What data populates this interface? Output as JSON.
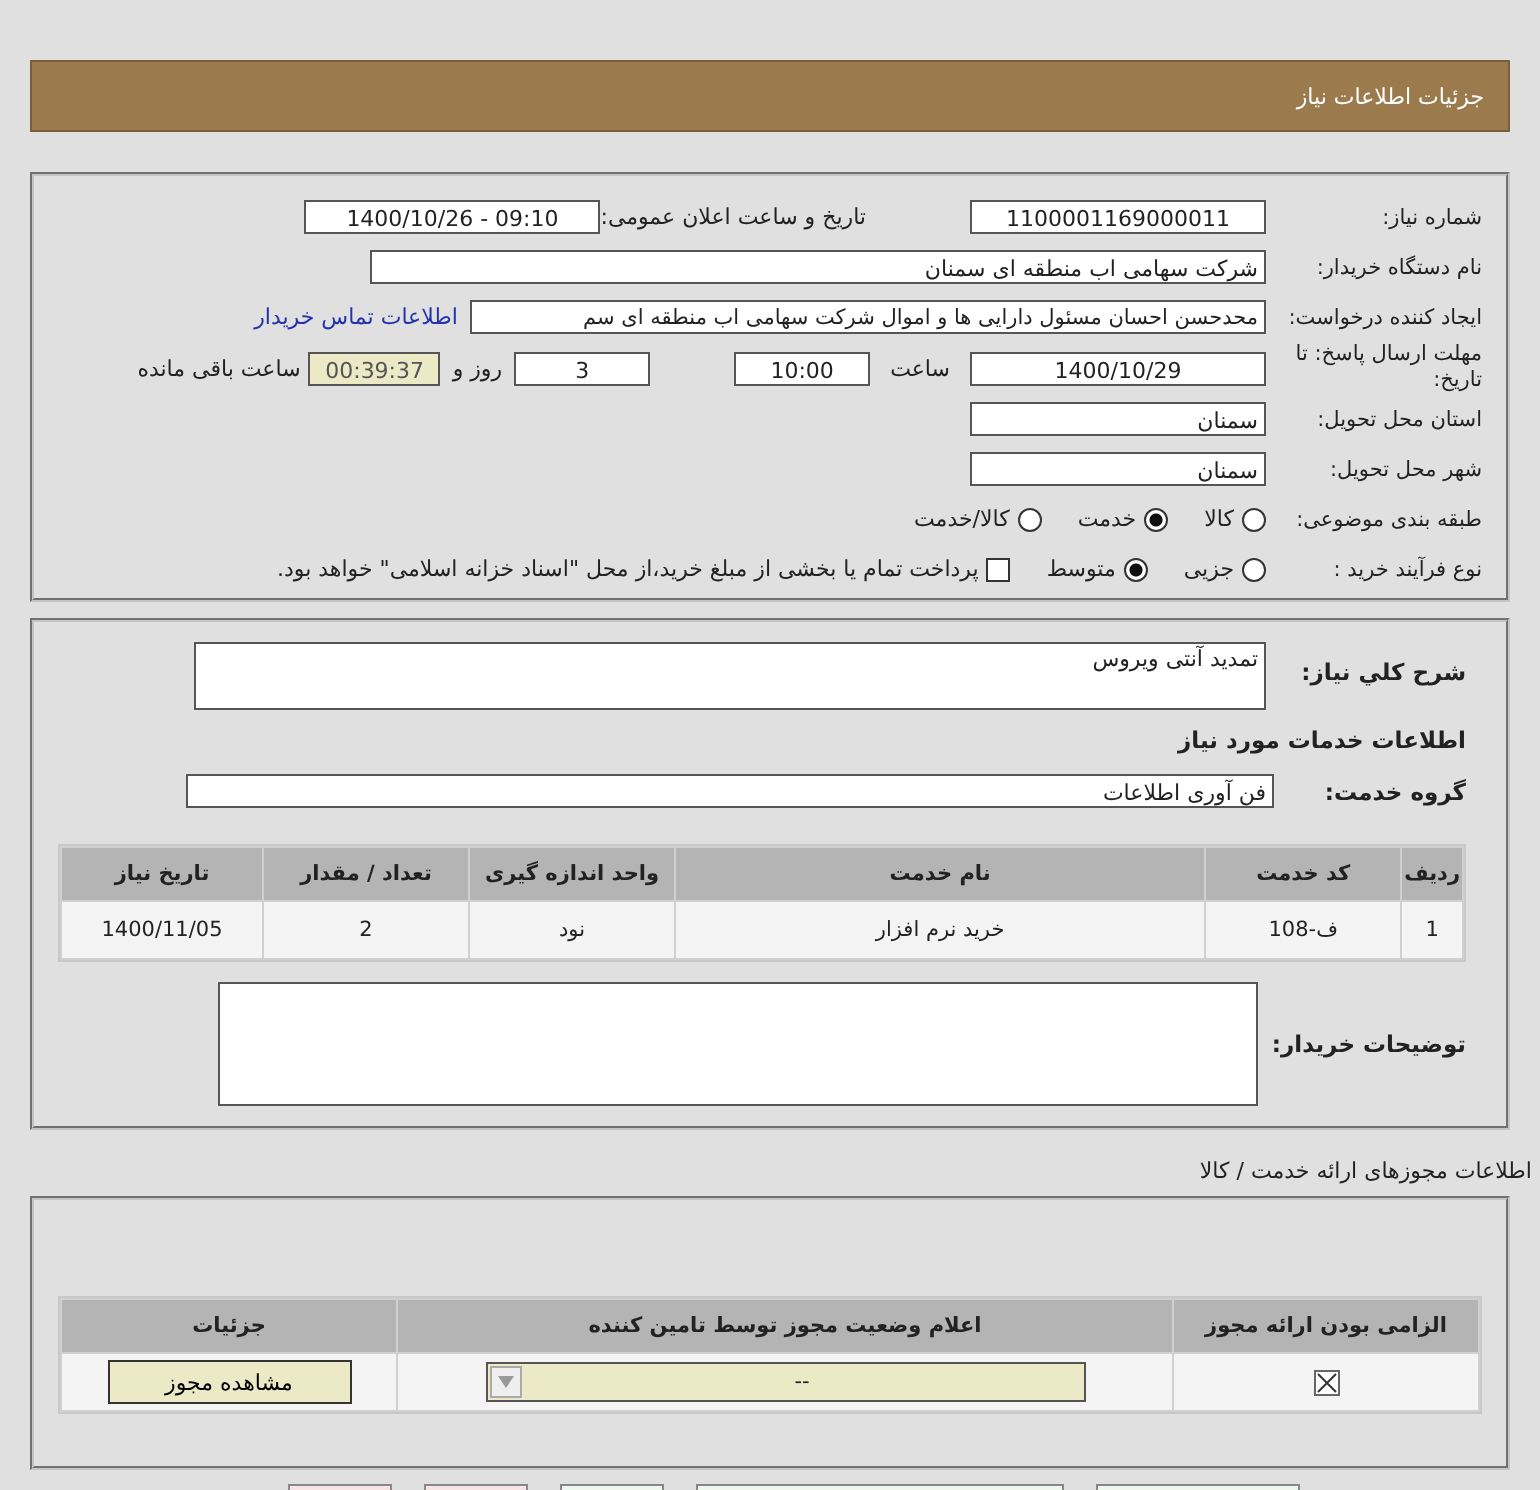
{
  "header": {
    "title": "جزئیات اطلاعات نیاز"
  },
  "need_number": {
    "label": "شماره نیاز:",
    "value": "1100001169000011"
  },
  "announce": {
    "label": "تاریخ و ساعت اعلان عمومی:",
    "value": "1400/10/26 - 09:10"
  },
  "buyer_org": {
    "label": "نام دستگاه خریدار:",
    "value": "شرکت سهامی اب منطقه ای سمنان"
  },
  "requester": {
    "label": "ایجاد کننده درخواست:",
    "value": "محدحسن احسان مسئول دارایی ها و اموال شرکت سهامی اب منطقه ای سم",
    "link": "اطلاعات تماس خریدار"
  },
  "deadline": {
    "label": "مهلت ارسال پاسخ: تا تاریخ:",
    "date": "1400/10/29",
    "time_label": "ساعت",
    "time": "10:00",
    "days": "3",
    "days_label": "روز و",
    "remaining": "00:39:37",
    "remaining_label": "ساعت باقی مانده"
  },
  "province": {
    "label": "استان محل تحویل:",
    "value": "سمنان"
  },
  "city": {
    "label": "شهر محل تحویل:",
    "value": "سمنان"
  },
  "category": {
    "label": "طبقه بندی موضوعی:",
    "options": [
      {
        "label": "کالا",
        "selected": false
      },
      {
        "label": "خدمت",
        "selected": true
      },
      {
        "label": "کالا/خدمت",
        "selected": false
      }
    ]
  },
  "process": {
    "label": "نوع فرآیند خرید :",
    "options": [
      {
        "label": "جزیی",
        "selected": false
      },
      {
        "label": "متوسط",
        "selected": true
      }
    ],
    "payment_checkbox": {
      "checked": false,
      "label": "پرداخت تمام یا بخشی از مبلغ خرید،از محل \"اسناد خزانه اسلامی\" خواهد بود."
    }
  },
  "description": {
    "label": "شرح کلي نياز:",
    "value": "تمدید آنتی ویروس"
  },
  "services_title": "اطلاعات خدمات مورد نیاز",
  "service_group": {
    "label": "گروه خدمت:",
    "value": "فن آوری اطلاعات"
  },
  "services_table": {
    "columns": [
      "ردیف",
      "کد خدمت",
      "نام خدمت",
      "واحد اندازه گیری",
      "تعداد / مقدار",
      "تاریخ نیاز"
    ],
    "rows": [
      [
        "1",
        "ف-108",
        "خرید نرم افزار",
        "نود",
        "2",
        "1400/11/05"
      ]
    ]
  },
  "buyer_notes": {
    "label": "توضیحات خریدار:"
  },
  "licenses_title": "اطلاعات مجوزهای ارائه خدمت / کالا",
  "licenses_table": {
    "columns": [
      "الزامی بودن ارائه مجوز",
      "اعلام وضعیت مجوز توسط تامین کننده",
      "جزئیات"
    ],
    "rows": [
      {
        "required": true,
        "status": "--",
        "button": "مشاهده مجوز"
      }
    ]
  }
}
